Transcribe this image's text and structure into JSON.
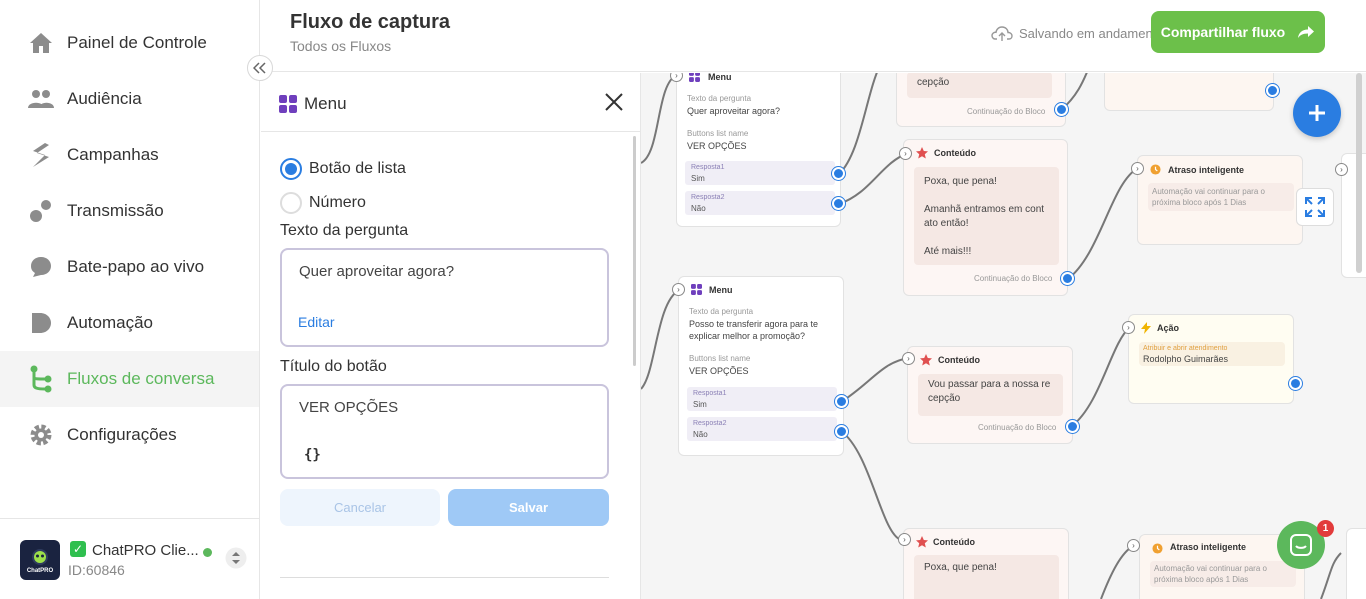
{
  "sidebar": {
    "items": [
      {
        "label": "Painel de Controle",
        "icon": "home-icon"
      },
      {
        "label": "Audiência",
        "icon": "users-icon"
      },
      {
        "label": "Campanhas",
        "icon": "campaigns-icon"
      },
      {
        "label": "Transmissão",
        "icon": "broadcast-icon"
      },
      {
        "label": "Bate-papo ao vivo",
        "icon": "chat-icon"
      },
      {
        "label": "Automação",
        "icon": "automation-icon"
      },
      {
        "label": "Fluxos de conversa",
        "icon": "flow-icon",
        "active": true
      },
      {
        "label": "Configurações",
        "icon": "gear-icon"
      }
    ],
    "account": {
      "name": "ChatPRO Clie...",
      "id": "ID:60846",
      "logo_text": "ChatPRO"
    }
  },
  "header": {
    "title": "Fluxo de captura",
    "breadcrumb": "Todos os Fluxos",
    "status": "Salvando em andamento",
    "share_label": "Compartilhar fluxo"
  },
  "panel": {
    "title": "Menu",
    "radio_list": "Botão de lista",
    "radio_number": "Número",
    "question_label": "Texto da pergunta",
    "question_value": "Quer aproveitar agora?",
    "edit_link": "Editar",
    "button_title_label": "Título do botão",
    "button_title_value": "VER OPÇÕES",
    "variable_glyph": "{}",
    "cancel_label": "Cancelar",
    "save_label": "Salvar"
  },
  "canvas": {
    "node1": {
      "title": "Menu",
      "q_label": "Texto da pergunta",
      "q_value": "Quer aproveitar agora?",
      "list_label": "Buttons list name",
      "list_value": "VER OPÇÕES",
      "resp1_key": "Resposta1",
      "resp1_val": "Sim",
      "resp2_key": "Resposta2",
      "resp2_val": "Não"
    },
    "node_top_content": {
      "bubble": "cepção",
      "continue": "Continuação do Bloco"
    },
    "node2": {
      "title": "Conteúdo",
      "line1": "Poxa, que pena!",
      "line2": "Amanhã entramos em cont",
      "line3": "ato então!",
      "line4": "Até mais!!!",
      "continue": "Continuação do Bloco"
    },
    "node3": {
      "title": "Atraso inteligente",
      "text1": "Automação vai continuar para o",
      "text2": "próxima bloco após 1 Dias"
    },
    "node4": {
      "title": "Menu",
      "q_label": "Texto da pergunta",
      "q_line1": "Posso te transferir agora para te",
      "q_line2": "explicar melhor a promoção?",
      "list_label": "Buttons list name",
      "list_value": "VER OPÇÕES",
      "resp1_key": "Resposta1",
      "resp1_val": "Sim",
      "resp2_key": "Resposta2",
      "resp2_val": "Não"
    },
    "node5": {
      "title": "Conteúdo",
      "line1": "Vou passar para a nossa re",
      "line2": "cepção",
      "continue": "Continuação do Bloco"
    },
    "node6": {
      "title": "Ação",
      "sub": "Atribuir e abrir atendimento",
      "value": "Rodolpho Guimarães"
    },
    "node7": {
      "title": "Conteúdo",
      "line1": "Poxa, que pena!"
    },
    "node8": {
      "title": "Atraso inteligente",
      "text1": "Automação vai continuar para o",
      "text2": "próxima bloco após 1 Dias"
    },
    "chat_badge": "1"
  },
  "colors": {
    "accent_green": "#6cc04a",
    "primary_blue": "#2a7de1",
    "active_nav": "#5cb85c"
  }
}
